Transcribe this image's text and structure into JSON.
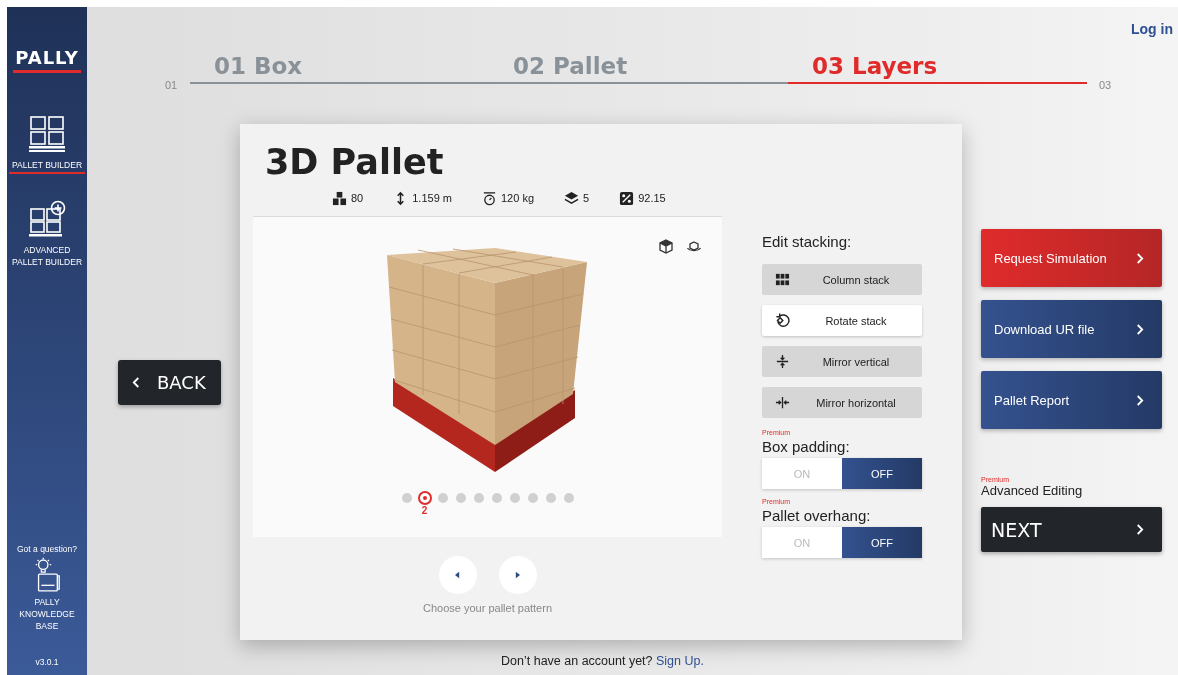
{
  "sidebar": {
    "logo": "PALLY",
    "items": [
      {
        "label": "PALLET BUILDER",
        "kind": "basic",
        "selected": true
      },
      {
        "label": "ADVANCED PALLET BUILDER",
        "kind": "advanced",
        "selected": false
      }
    ],
    "help_title": "Got a question?",
    "help_label": "PALLY KNOWLEDGE BASE",
    "version": "v3.0.1"
  },
  "login": "Log in",
  "steps": {
    "start": "01",
    "end": "03",
    "items": [
      {
        "label": "01 Box",
        "selected": false
      },
      {
        "label": "02 Pallet",
        "selected": false
      },
      {
        "label": "03 Layers",
        "selected": true
      }
    ]
  },
  "back": "BACK",
  "card": {
    "title": "3D Pallet",
    "stats": [
      {
        "kind": "boxes",
        "value": "80"
      },
      {
        "kind": "height",
        "value": "1.159 m"
      },
      {
        "kind": "weight",
        "value": "120 kg"
      },
      {
        "kind": "layers",
        "value": "5"
      },
      {
        "kind": "percent",
        "value": "92.15"
      }
    ],
    "view_buttons": [
      {
        "kind": "top"
      },
      {
        "kind": "rotate"
      }
    ],
    "current_pattern": "2",
    "patterns": [
      {
        "selected": false
      },
      {
        "selected": true
      },
      {
        "selected": false
      },
      {
        "selected": false
      },
      {
        "selected": false
      },
      {
        "selected": false
      },
      {
        "selected": false
      },
      {
        "selected": false
      },
      {
        "selected": false
      },
      {
        "selected": false
      }
    ],
    "caption": "Choose your pallet pattern"
  },
  "stacking": {
    "title": "Edit stacking:",
    "buttons": [
      {
        "kind": "column",
        "label": "Column stack",
        "selected": false
      },
      {
        "kind": "rotate",
        "label": "Rotate stack",
        "selected": true
      },
      {
        "kind": "mirror_v",
        "label": "Mirror vertical",
        "selected": false
      },
      {
        "kind": "mirror_h",
        "label": "Mirror horizontal",
        "selected": false
      }
    ],
    "toggles": [
      {
        "badge": "Premium",
        "label": "Box padding:",
        "options": [
          {
            "label": "ON",
            "selected": false
          },
          {
            "label": "OFF",
            "selected": true
          }
        ]
      },
      {
        "badge": "Premium",
        "label": "Pallet overhang:",
        "options": [
          {
            "label": "ON",
            "selected": false
          },
          {
            "label": "OFF",
            "selected": true
          }
        ]
      }
    ]
  },
  "actions": [
    {
      "kind": "primary",
      "label": "Request Simulation"
    },
    {
      "kind": "secondary",
      "label": "Download UR file"
    },
    {
      "kind": "secondary",
      "label": "Pallet Report"
    }
  ],
  "advanced": {
    "badge": "Premium",
    "label": "Advanced Editing"
  },
  "next": "NEXT",
  "footer": {
    "text": "Don’t have an account yet?",
    "link": "Sign Up."
  }
}
